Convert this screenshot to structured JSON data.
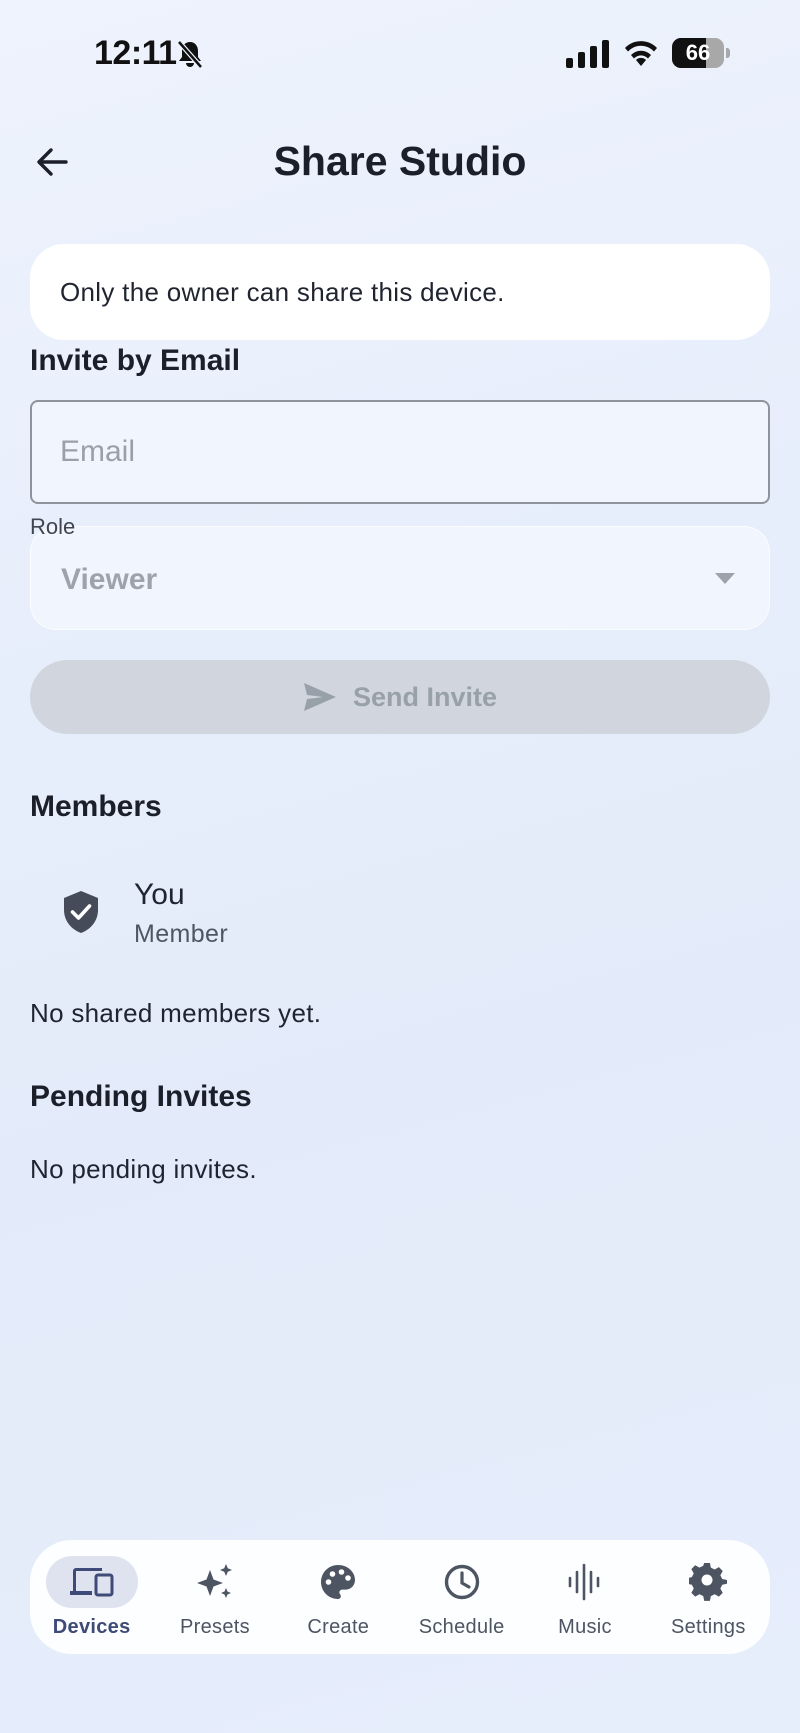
{
  "status_bar": {
    "time": "12:11",
    "battery": "66",
    "battery_level": 0.66
  },
  "header": {
    "title": "Share Studio"
  },
  "notice": {
    "text": "Only the owner can share this device."
  },
  "invite": {
    "heading": "Invite by Email",
    "email_placeholder": "Email",
    "email_value": "",
    "role_label": "Role",
    "role_value": "Viewer",
    "send_label": "Send Invite"
  },
  "members": {
    "heading": "Members",
    "items": [
      {
        "name": "You",
        "role": "Member"
      }
    ],
    "empty_text": "No shared members yet."
  },
  "pending": {
    "heading": "Pending Invites",
    "empty_text": "No pending invites."
  },
  "nav": {
    "items": [
      {
        "label": "Devices",
        "icon": "devices-icon",
        "active": true
      },
      {
        "label": "Presets",
        "icon": "sparkle-icon",
        "active": false
      },
      {
        "label": "Create",
        "icon": "palette-icon",
        "active": false
      },
      {
        "label": "Schedule",
        "icon": "clock-icon",
        "active": false
      },
      {
        "label": "Music",
        "icon": "waveform-icon",
        "active": false
      },
      {
        "label": "Settings",
        "icon": "gear-icon",
        "active": false
      }
    ]
  },
  "colors": {
    "nav_active": "#3e4a77",
    "button_disabled_bg": "#d1d6de",
    "card_bg": "#ffffff"
  }
}
